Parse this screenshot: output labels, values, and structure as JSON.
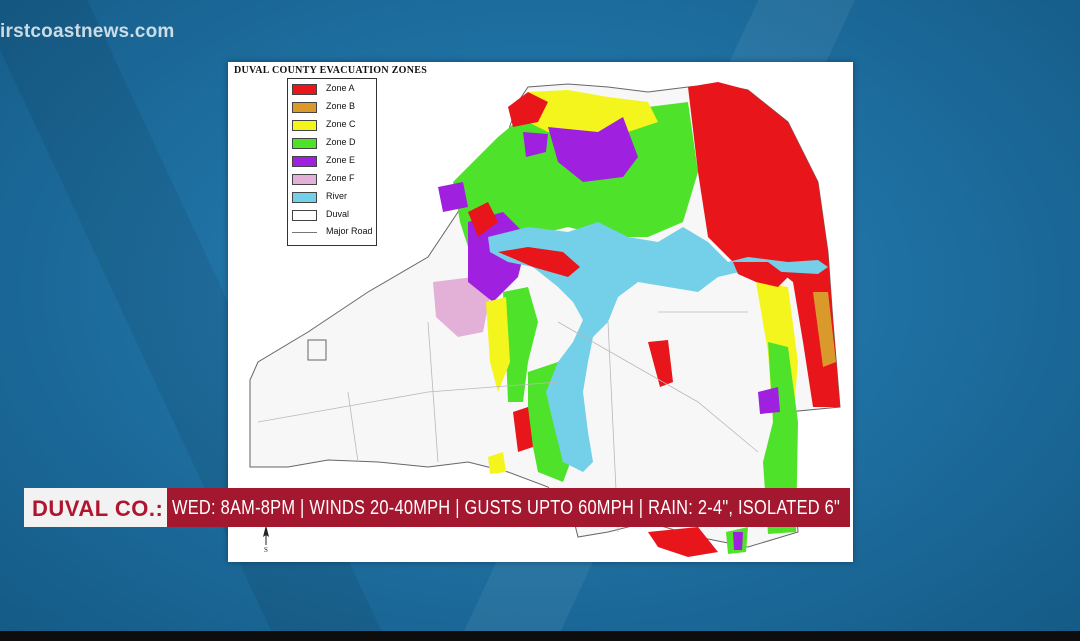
{
  "watermark": "irstcoastnews.com",
  "map": {
    "title": "DUVAL COUNTY EVACUATION  ZONES",
    "legend": [
      {
        "label": "Zone A",
        "color": "#e8151b"
      },
      {
        "label": "Zone B",
        "color": "#d99a2b"
      },
      {
        "label": "Zone C",
        "color": "#f5f51e"
      },
      {
        "label": "Zone D",
        "color": "#4fe22b"
      },
      {
        "label": "Zone E",
        "color": "#a020e0"
      },
      {
        "label": "Zone F",
        "color": "#e3b0d8"
      },
      {
        "label": "River",
        "color": "#74cfe8"
      },
      {
        "label": "Duval",
        "color": "#ffffff"
      },
      {
        "label": "Major Road",
        "color": "#777777"
      }
    ],
    "compass_label": "S"
  },
  "lower_third": {
    "location": "DUVAL CO.:",
    "details": "WED: 8AM-8PM  |  WINDS 20-40MPH  |  GUSTS UPTO 60MPH  |  RAIN: 2-4\", ISOLATED 6\""
  }
}
